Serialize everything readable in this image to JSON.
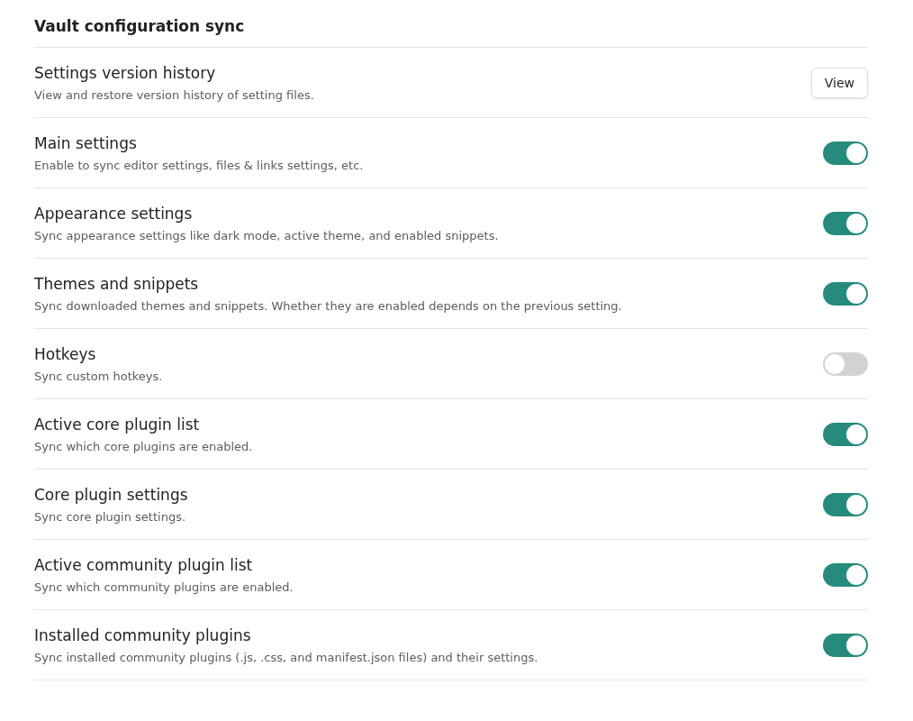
{
  "heading": "Vault configuration sync",
  "settings": [
    {
      "kind": "button",
      "name": "Settings version history",
      "description": "View and restore version history of setting files.",
      "button": "View"
    },
    {
      "kind": "toggle",
      "name": "Main settings",
      "description": "Enable to sync editor settings, files & links settings, etc.",
      "on": true
    },
    {
      "kind": "toggle",
      "name": "Appearance settings",
      "description": "Sync appearance settings like dark mode, active theme, and enabled snippets.",
      "on": true
    },
    {
      "kind": "toggle",
      "name": "Themes and snippets",
      "description": "Sync downloaded themes and snippets. Whether they are enabled depends on the previous setting.",
      "on": true
    },
    {
      "kind": "toggle",
      "name": "Hotkeys",
      "description": "Sync custom hotkeys.",
      "on": false
    },
    {
      "kind": "toggle",
      "name": "Active core plugin list",
      "description": "Sync which core plugins are enabled.",
      "on": true
    },
    {
      "kind": "toggle",
      "name": "Core plugin settings",
      "description": "Sync core plugin settings.",
      "on": true
    },
    {
      "kind": "toggle",
      "name": "Active community plugin list",
      "description": "Sync which community plugins are enabled.",
      "on": true
    },
    {
      "kind": "toggle",
      "name": "Installed community plugins",
      "description": "Sync installed community plugins (.js, .css, and manifest.json files) and their settings.",
      "on": true
    }
  ]
}
